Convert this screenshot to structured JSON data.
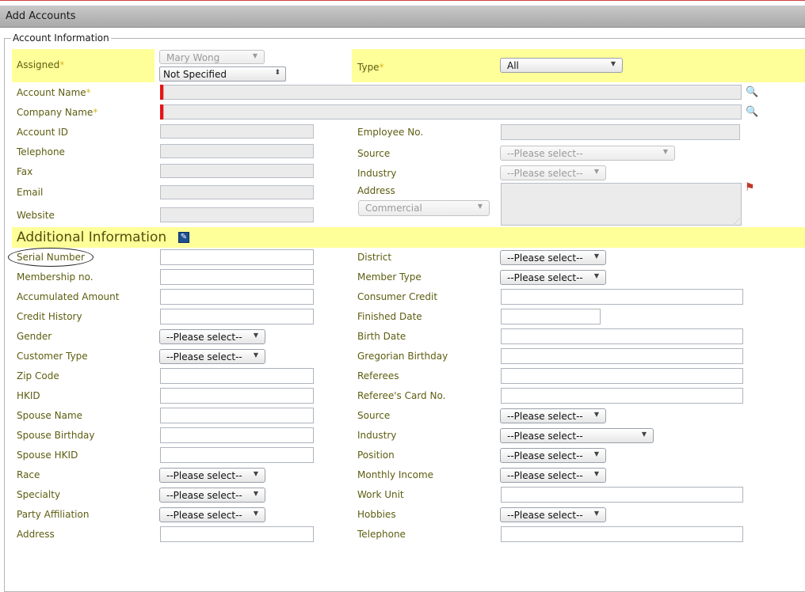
{
  "window": {
    "title": "Add Accounts"
  },
  "section_account": {
    "legend": "Account Information",
    "assigned_label": "Assigned",
    "required_mark": "*",
    "assigned_user": "Mary Wong",
    "assigned_option": "Not Specified",
    "type_label": "Type",
    "type_value": "All",
    "account_name_label": "Account Name",
    "company_name_label": "Company Name",
    "account_id_label": "Account ID",
    "employee_no_label": "Employee No.",
    "telephone_label": "Telephone",
    "source_label": "Source",
    "source_value": "--Please select--",
    "fax_label": "Fax",
    "industry_label": "Industry",
    "industry_value": "--Please select--",
    "email_label": "Email",
    "address_label": "Address",
    "address_type": "Commercial",
    "website_label": "Website"
  },
  "section_additional": {
    "title": "Additional Information",
    "placeholder_select": "--Please select--"
  },
  "left_fields": [
    {
      "label": "Serial Number",
      "control": "text"
    },
    {
      "label": "Membership no.",
      "control": "text"
    },
    {
      "label": "Accumulated Amount",
      "control": "text"
    },
    {
      "label": "Credit History",
      "control": "text"
    },
    {
      "label": "Gender",
      "control": "select"
    },
    {
      "label": "Customer Type",
      "control": "select"
    },
    {
      "label": "Zip Code",
      "control": "text"
    },
    {
      "label": "HKID",
      "control": "text"
    },
    {
      "label": "Spouse Name",
      "control": "text"
    },
    {
      "label": "Spouse Birthday",
      "control": "text"
    },
    {
      "label": "Spouse HKID",
      "control": "text"
    },
    {
      "label": "Race",
      "control": "select"
    },
    {
      "label": "Specialty",
      "control": "select"
    },
    {
      "label": "Party Affiliation",
      "control": "select"
    },
    {
      "label": "Address",
      "control": "text"
    }
  ],
  "right_fields": [
    {
      "label": "District",
      "control": "select"
    },
    {
      "label": "Member Type",
      "control": "select"
    },
    {
      "label": "Consumer Credit",
      "control": "text"
    },
    {
      "label": "Finished Date",
      "control": "date"
    },
    {
      "label": "Birth Date",
      "control": "text"
    },
    {
      "label": "Gregorian Birthday",
      "control": "text"
    },
    {
      "label": "Referees",
      "control": "text"
    },
    {
      "label": "Referee's Card No.",
      "control": "text"
    },
    {
      "label": "Source",
      "control": "select"
    },
    {
      "label": "Industry",
      "control": "select-wide"
    },
    {
      "label": "Position",
      "control": "select"
    },
    {
      "label": "Monthly Income",
      "control": "select"
    },
    {
      "label": "Work Unit",
      "control": "text"
    },
    {
      "label": "Hobbies",
      "control": "select"
    },
    {
      "label": "Telephone",
      "control": "text"
    }
  ],
  "colors": {
    "highlight_row": "#ffff99",
    "label_text": "#5d5d11",
    "required": "#d8b820",
    "mandatory_bar": "#e11111",
    "header_bar": "#b4b4b4"
  },
  "icons": {
    "lookup": "magnifier-icon",
    "edit": "edit-note-icon",
    "map": "map-icon",
    "dropdown": "dropdown-arrow-icon"
  }
}
